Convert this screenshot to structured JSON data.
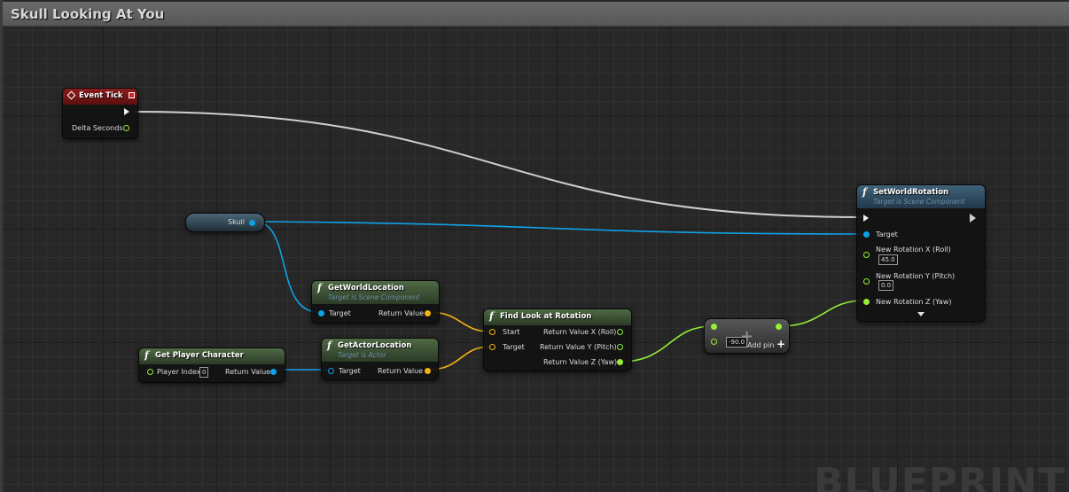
{
  "window": {
    "title": "Skull Looking At You"
  },
  "watermark": "BLUEPRINT",
  "nodes": {
    "event_tick": {
      "title": "Event Tick",
      "pin_delta": "Delta Seconds"
    },
    "skull_var": {
      "label": "Skull"
    },
    "get_world_location": {
      "title": "GetWorldLocation",
      "subtitle": "Target is Scene Component",
      "pin_target": "Target",
      "pin_return": "Return Value"
    },
    "get_actor_location": {
      "title": "GetActorLocation",
      "subtitle": "Target is Actor",
      "pin_target": "Target",
      "pin_return": "Return Value"
    },
    "get_player_character": {
      "title": "Get Player Character",
      "pin_player_index": "Player Index",
      "player_index_value": "0",
      "pin_return": "Return Value"
    },
    "find_look_at_rotation": {
      "title": "Find Look at Rotation",
      "pin_start": "Start",
      "pin_target": "Target",
      "out_x": "Return Value X (Roll)",
      "out_y": "Return Value Y (Pitch)",
      "out_z": "Return Value Z (Yaw)"
    },
    "add_node": {
      "value": "-90.0",
      "add_pin_label": "Add pin"
    },
    "set_world_rotation": {
      "title": "SetWorldRotation",
      "subtitle": "Target is Scene Component",
      "pin_target": "Target",
      "pin_x": "New Rotation X (Roll)",
      "value_x": "45.0",
      "pin_y": "New Rotation Y (Pitch)",
      "value_y": "0.0",
      "pin_z": "New Rotation Z (Yaw)"
    }
  },
  "colors": {
    "exec_wire": "#d0d0d0",
    "object_wire": "#0fa1e8",
    "vector_wire": "#f3b314",
    "float_wire": "#96ee38",
    "event_header": "#8b1c1c",
    "function_header": "#4f6a44"
  },
  "icons": {
    "event": "event-diamond-icon",
    "function": "function-f-icon",
    "add": "plus-icon",
    "expand": "chevron-down-icon"
  }
}
